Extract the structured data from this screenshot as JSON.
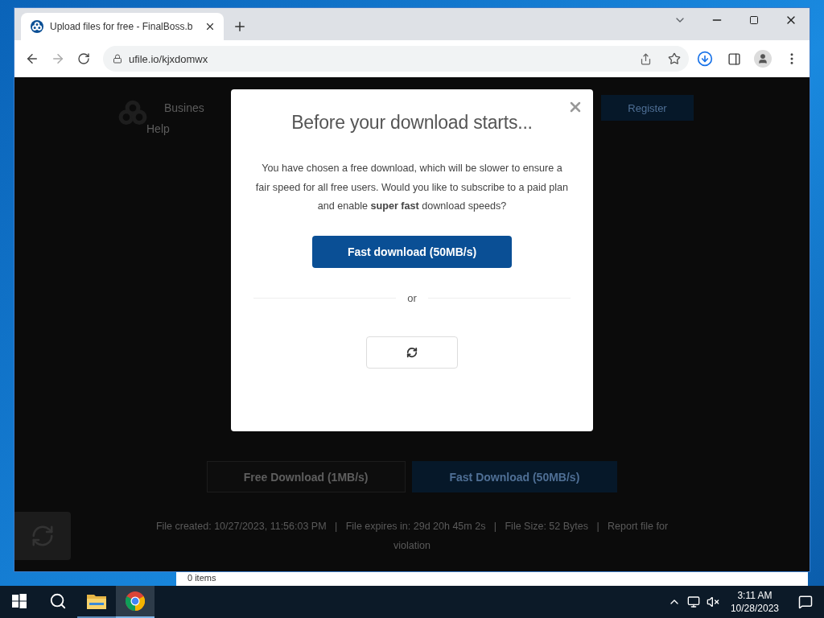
{
  "browser": {
    "tabs": [
      {
        "title": "Upload files for free - FinalBoss.b",
        "selected": true
      }
    ],
    "address": "ufile.io/kjxdomwx"
  },
  "page": {
    "nav": [
      "Busines",
      "Help"
    ],
    "register": "Register",
    "buttons": [
      {
        "label": "Free Download (1MB/s)",
        "kind": "free"
      },
      {
        "label": "Fast Download (50MB/s)",
        "kind": "fast"
      }
    ],
    "file_info": "File created: 10/27/2023, 11:56:03 PM   |   File expires in: 29d 20h 45m 2s   |   File Size: 52 Bytes   |   Report file for violation"
  },
  "modal": {
    "title": "Before your download starts...",
    "message": "You have chosen a free download, which will be slower to ensure a fair speed for all free users. Would you like to subscribe to a paid plan and enable **super fast** download speeds?",
    "primary_button": "Fast download (50MB/s)",
    "separator": "or"
  },
  "explorer": {
    "status": "0 items"
  },
  "taskbar": {
    "apps": [
      {
        "kind": "explorer",
        "selected": false
      },
      {
        "kind": "chrome",
        "selected": true
      }
    ],
    "time": "3:11 AM",
    "date": "10/28/2023"
  }
}
